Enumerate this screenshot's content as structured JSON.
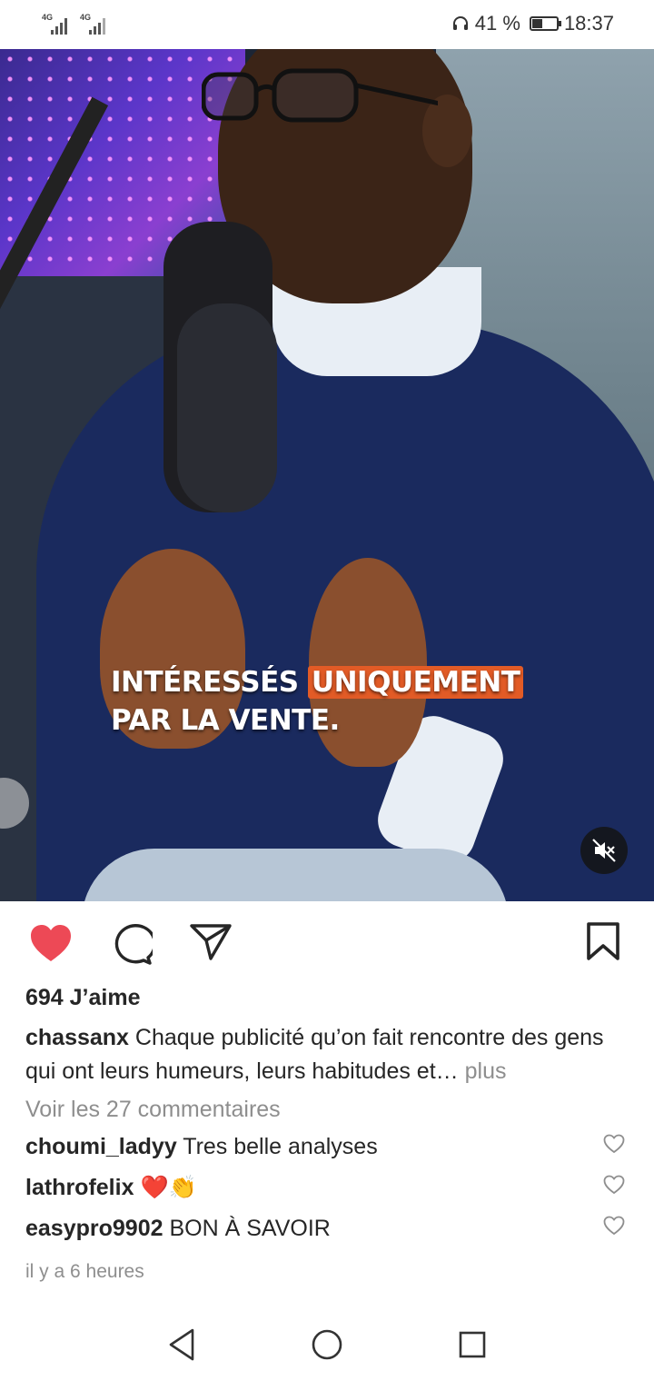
{
  "status_bar": {
    "signal1_label": "4G",
    "signal2_label": "4G",
    "battery_percent": "41 %",
    "battery_level": 0.41,
    "time": "18:37"
  },
  "video": {
    "caption_line1_a": "INTÉRESSÉS",
    "caption_line1_highlight": "UNIQUEMENT",
    "caption_line2": "PAR LA VENTE.",
    "highlight_color": "#e25b26",
    "muted": true
  },
  "actions": {
    "liked": true,
    "like_color": "#ed4956",
    "icons": [
      "heart-icon",
      "comment-icon",
      "share-icon",
      "bookmark-icon"
    ]
  },
  "post": {
    "likes_text": "694 J’aime",
    "author": "chassanx",
    "caption": "Chaque publicité qu’on fait rencontre des gens qui ont leurs humeurs, leurs habitudes et…",
    "more_label": "plus",
    "view_comments": "Voir les 27 commentaires",
    "comments": [
      {
        "user": "choumi_ladyy",
        "text": "Tres belle analyses"
      },
      {
        "user": "lathrofelix",
        "text": "❤️👏"
      },
      {
        "user": "easypro9902",
        "text": "BON À SAVOIR"
      }
    ],
    "time_ago": "il y a 6 heures"
  }
}
